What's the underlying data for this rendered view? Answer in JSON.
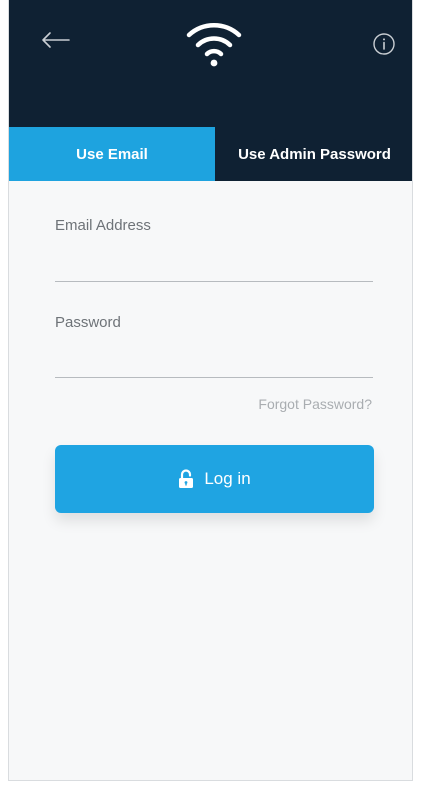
{
  "header": {
    "back_icon": "back-arrow-icon",
    "wifi_icon": "wifi-icon",
    "info_icon": "info-icon"
  },
  "tabs": [
    {
      "label": "Use Email",
      "active": true
    },
    {
      "label": "Use Admin Password",
      "active": false
    }
  ],
  "form": {
    "email_label": "Email Address",
    "email_value": "",
    "password_label": "Password",
    "password_value": "",
    "forgot_label": "Forgot Password?",
    "login_label": "Log in",
    "login_icon": "unlock-icon"
  },
  "colors": {
    "header_bg": "#0f2133",
    "accent": "#1ea3df",
    "form_bg": "#f7f8f9"
  }
}
